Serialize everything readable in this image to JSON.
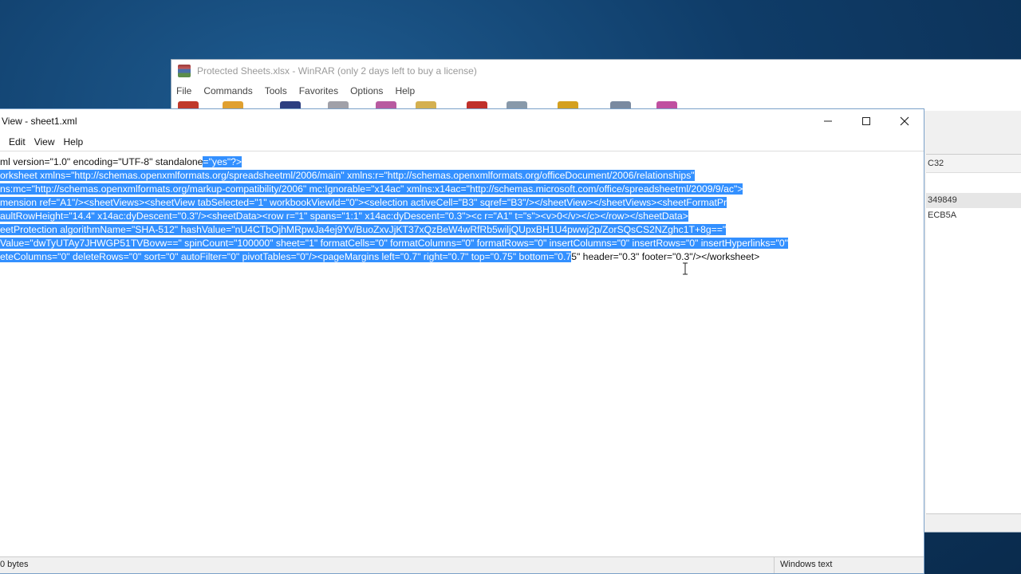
{
  "winrar": {
    "title": "Protected Sheets.xlsx - WinRAR (only 2 days left to buy a license)",
    "menu": [
      "File",
      "Commands",
      "Tools",
      "Favorites",
      "Options",
      "Help"
    ],
    "right_header": "C32",
    "right_rows": [
      "349849",
      "ECB5A"
    ]
  },
  "notepad": {
    "title": "View - sheet1.xml",
    "menu": [
      "Edit",
      "View",
      "Help"
    ],
    "lines": [
      {
        "sel": "ml version=\"1.0\" encoding=\"UTF-8\" standalone",
        "rest": "=\"yes\"?>",
        "sel_on_rest": true
      },
      {
        "sel": "orksheet xmlns=\"http://schemas.openxmlformats.org/spreadsheetml/2006/main\" xmlns:r=\"http://schemas.openxmlformats.org/officeDocument/2006/relationships\"",
        "rest": ""
      },
      {
        "sel": "ns:mc=\"http://schemas.openxmlformats.org/markup-compatibility/2006\" mc:Ignorable=\"x14ac\" xmlns:x14ac=\"http://schemas.microsoft.com/office/spreadsheetml/2009/9/ac\">",
        "rest": ""
      },
      {
        "sel": "mension ref=\"A1\"/><sheetViews><sheetView tabSelected=\"1\" workbookViewId=\"0\"><selection activeCell=\"B3\" sqref=\"B3\"/></sheetView></sheetViews><sheetFormatPr",
        "rest": ""
      },
      {
        "sel": "aultRowHeight=\"14.4\" x14ac:dyDescent=\"0.3\"/><sheetData><row r=\"1\" spans=\"1:1\" x14ac:dyDescent=\"0.3\"><c r=\"A1\" t=\"s\"><v>0</v></c></row></sheetData>",
        "rest": ""
      },
      {
        "sel": "eetProtection algorithmName=\"SHA-512\" hashValue=\"nU4CTbOjhMRpwJa4ej9Yv/BuoZxvJjKT37xQzBeW4wRfRb5wiljQUpxBH1U4pwwj2p/ZorSQsCS2NZghc1T+8g==\"",
        "rest": ""
      },
      {
        "sel": "Value=\"dwTyUTAy7JHWGP51TVBovw==\" spinCount=\"100000\" sheet=\"1\" formatCells=\"0\" formatColumns=\"0\" formatRows=\"0\" insertColumns=\"0\" insertRows=\"0\" insertHyperlinks=\"0\"",
        "rest": ""
      },
      {
        "sel": "eteColumns=\"0\" deleteRows=\"0\" sort=\"0\" autoFilter=\"0\" pivotTables=\"0\"/><pageMargins left=\"0.7\" right=\"0.7\" top=\"0.75\" bottom=\"0.7",
        "rest": "5\" header=\"0.3\" footer=\"0.3\"/></worksheet>"
      }
    ],
    "status_left": "0 bytes",
    "status_right": "Windows text"
  },
  "colors": {
    "selection": "#3390ff",
    "desktop": "#0f3c68"
  }
}
